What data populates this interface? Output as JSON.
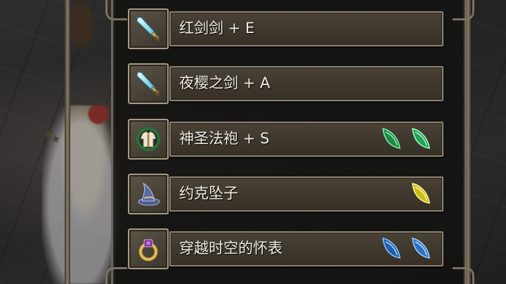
{
  "items": [
    {
      "name": "红剑剑 + E",
      "icon": "sword-icon",
      "gems": []
    },
    {
      "name": "夜樱之剑 + A",
      "icon": "sword-icon",
      "gems": []
    },
    {
      "name": "神圣法袍 + S",
      "icon": "robe-icon",
      "gems": [
        "green",
        "green"
      ]
    },
    {
      "name": "约克坠子",
      "icon": "wizard-hat-icon",
      "gems": [
        "yellow"
      ]
    },
    {
      "name": "穿越时空的怀表",
      "icon": "ring-icon",
      "gems": [
        "blue",
        "blue"
      ]
    }
  ],
  "colors": {
    "gem_green": "#2fae5a",
    "gem_yellow": "#e8dc2a",
    "gem_blue": "#2f7fd6",
    "text": "#f1ede4",
    "bar": "#3f382e",
    "frame": "#8e8370"
  }
}
